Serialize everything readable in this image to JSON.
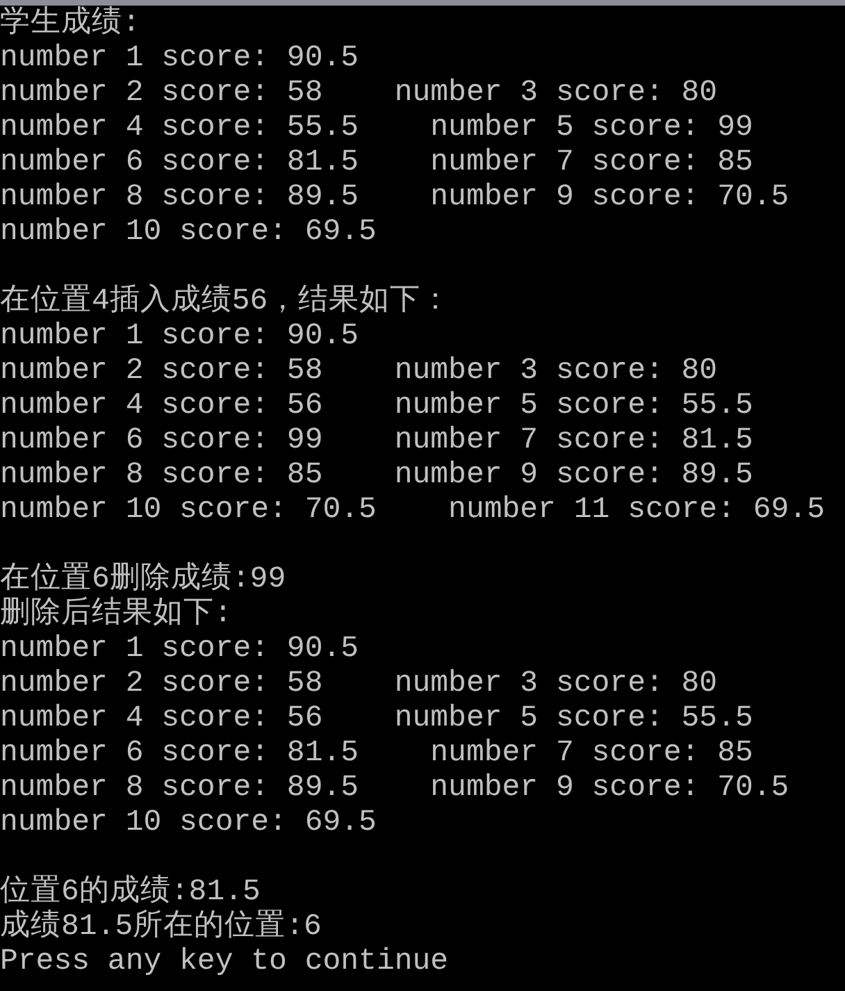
{
  "console": {
    "lines": [
      {
        "kind": "text",
        "items": [
          "学生成绩:"
        ]
      },
      {
        "kind": "text",
        "items": [
          "number 1 score: 90.5"
        ]
      },
      {
        "kind": "text",
        "items": [
          "number 2 score: 58",
          "number 3 score: 80"
        ]
      },
      {
        "kind": "text",
        "items": [
          "number 4 score: 55.5",
          "number 5 score: 99"
        ]
      },
      {
        "kind": "text",
        "items": [
          "number 6 score: 81.5",
          "number 7 score: 85"
        ]
      },
      {
        "kind": "text",
        "items": [
          "number 8 score: 89.5",
          "number 9 score: 70.5"
        ]
      },
      {
        "kind": "text",
        "items": [
          "number 10 score: 69.5"
        ]
      },
      {
        "kind": "blank"
      },
      {
        "kind": "text",
        "items": [
          "在位置4插入成绩56，结果如下："
        ]
      },
      {
        "kind": "text",
        "items": [
          "number 1 score: 90.5"
        ]
      },
      {
        "kind": "text",
        "items": [
          "number 2 score: 58",
          "number 3 score: 80"
        ]
      },
      {
        "kind": "text",
        "items": [
          "number 4 score: 56",
          "number 5 score: 55.5"
        ]
      },
      {
        "kind": "text",
        "items": [
          "number 6 score: 99",
          "number 7 score: 81.5"
        ]
      },
      {
        "kind": "text",
        "items": [
          "number 8 score: 85",
          "number 9 score: 89.5"
        ]
      },
      {
        "kind": "text",
        "items": [
          "number 10 score: 70.5",
          "number 11 score: 69.5"
        ]
      },
      {
        "kind": "blank"
      },
      {
        "kind": "text",
        "items": [
          "在位置6删除成绩:99"
        ]
      },
      {
        "kind": "text",
        "items": [
          "删除后结果如下:"
        ]
      },
      {
        "kind": "text",
        "items": [
          "number 1 score: 90.5"
        ]
      },
      {
        "kind": "text",
        "items": [
          "number 2 score: 58",
          "number 3 score: 80"
        ]
      },
      {
        "kind": "text",
        "items": [
          "number 4 score: 56",
          "number 5 score: 55.5"
        ]
      },
      {
        "kind": "text",
        "items": [
          "number 6 score: 81.5",
          "number 7 score: 85"
        ]
      },
      {
        "kind": "text",
        "items": [
          "number 8 score: 89.5",
          "number 9 score: 70.5"
        ]
      },
      {
        "kind": "text",
        "items": [
          "number 10 score: 69.5"
        ]
      },
      {
        "kind": "blank"
      },
      {
        "kind": "text",
        "items": [
          "位置6的成绩:81.5"
        ]
      },
      {
        "kind": "text",
        "items": [
          "成绩81.5所在的位置:6"
        ]
      },
      {
        "kind": "text",
        "items": [
          "Press any key to continue"
        ]
      }
    ]
  }
}
